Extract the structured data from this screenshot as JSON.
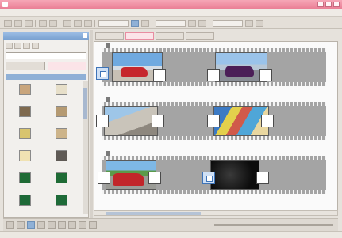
{
  "window": {
    "title": "",
    "title_color": "#ea7f95"
  },
  "menu": {
    "items": []
  },
  "toolbar": {
    "buttons": [
      "new-icon",
      "open-icon",
      "save-icon",
      "undo-icon",
      "redo-icon",
      "cut-icon",
      "copy-icon",
      "paste-icon",
      "play-icon",
      "stop-icon",
      "zoom-icon",
      "settings-icon"
    ]
  },
  "left_panel": {
    "title": "",
    "tabs": [
      {
        "label": "",
        "active": false
      },
      {
        "label": "",
        "active": true
      }
    ],
    "effects": [
      {
        "label": "",
        "icon": "page-curl-icon"
      },
      {
        "label": "",
        "icon": "film-icon"
      },
      {
        "label": "",
        "icon": "book-icon"
      },
      {
        "label": "",
        "icon": "flip-icon"
      },
      {
        "label": "",
        "icon": "picture-icon"
      },
      {
        "label": "",
        "icon": "frame-icon"
      },
      {
        "label": "",
        "icon": "slide-icon"
      },
      {
        "label": "",
        "icon": "stack-icon"
      },
      {
        "label": "",
        "icon": "green-box-icon"
      },
      {
        "label": "",
        "icon": "green-box-2-icon"
      },
      {
        "label": "",
        "icon": "green-box-3-icon"
      },
      {
        "label": "",
        "icon": "green-box-4-icon"
      }
    ]
  },
  "storyboard": {
    "tabs": [
      {
        "label": "",
        "active": false
      },
      {
        "label": "",
        "active": true
      },
      {
        "label": "",
        "active": false
      },
      {
        "label": "",
        "active": false
      }
    ],
    "clips": [
      {
        "scene": "red-car-sky",
        "row": 0,
        "slot": 0
      },
      {
        "scene": "purple-car-sky",
        "row": 0,
        "slot": 1
      },
      {
        "scene": "gray-road-sky",
        "row": 1,
        "slot": 0
      },
      {
        "scene": "colorful-blurred-road",
        "row": 1,
        "slot": 1
      },
      {
        "scene": "red-car-road",
        "row": 2,
        "slot": 0
      },
      {
        "scene": "dark-night",
        "row": 2,
        "slot": 1
      }
    ]
  },
  "status": {
    "text": ""
  }
}
